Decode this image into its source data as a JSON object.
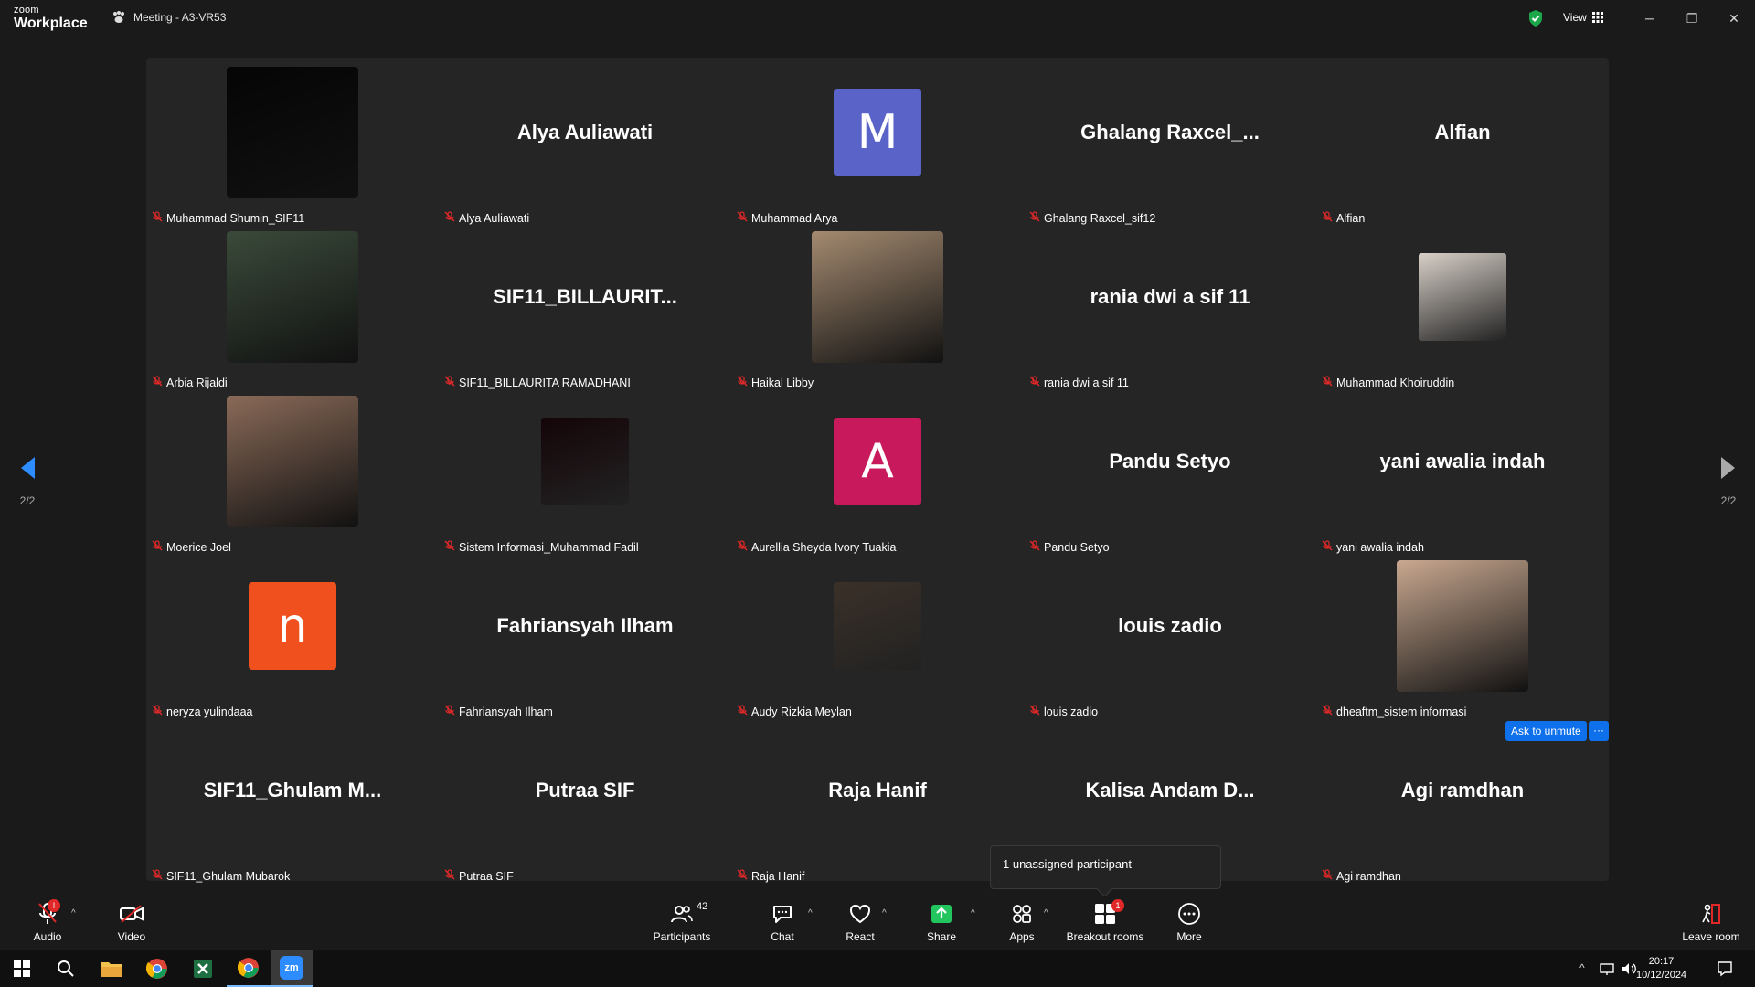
{
  "app": {
    "logo_top": "zoom",
    "logo_bottom": "Workplace",
    "meeting_title": "Meeting - A3-VR53",
    "view_label": "View"
  },
  "tiles": [
    {
      "label": "Muhammad Shumin_SIF11",
      "kind": "video",
      "color": "#050505"
    },
    {
      "label": "Alya Auliawati",
      "kind": "name",
      "display": "Alya Auliawati"
    },
    {
      "label": "Muhammad Arya",
      "kind": "avatar",
      "initial": "M",
      "color": "#5a64c8"
    },
    {
      "label": "Ghalang Raxcel_sif12",
      "kind": "name",
      "display": "Ghalang  Raxcel_..."
    },
    {
      "label": "Alfian",
      "kind": "name",
      "display": "Alfian"
    },
    {
      "label": "Arbia Rijaldi",
      "kind": "video",
      "color": "#3a4a3a"
    },
    {
      "label": "SIF11_BILLAURITA RAMADHANI",
      "kind": "name",
      "display": "SIF11_BILLAURIT..."
    },
    {
      "label": "Haikal Libby",
      "kind": "video",
      "color": "#a48a70"
    },
    {
      "label": "rania dwi a sif 11",
      "kind": "name",
      "display": "rania dwi a sif 11"
    },
    {
      "label": "Muhammad Khoiruddin",
      "kind": "photo",
      "color": "#d8d0c8"
    },
    {
      "label": "Moerice Joel",
      "kind": "video",
      "color": "#8a6a58"
    },
    {
      "label": "Sistem Informasi_Muhammad Fadil",
      "kind": "photo",
      "color": "#140508"
    },
    {
      "label": "Aurellia Sheyda Ivory Tuakia",
      "kind": "avatar",
      "initial": "A",
      "color": "#c8195c"
    },
    {
      "label": "Pandu Setyo",
      "kind": "name",
      "display": "Pandu Setyo"
    },
    {
      "label": "yani awalia indah",
      "kind": "name",
      "display": "yani awalia indah"
    },
    {
      "label": "neryza yulindaaa",
      "kind": "avatar",
      "initial": "n",
      "color": "#f0501e"
    },
    {
      "label": "Fahriansyah Ilham",
      "kind": "name",
      "display": "Fahriansyah Ilham"
    },
    {
      "label": "Audy Rizkia Meylan",
      "kind": "photo",
      "color": "#3a3028"
    },
    {
      "label": "louis zadio",
      "kind": "name",
      "display": "louis zadio"
    },
    {
      "label": "dheaftm_sistem informasi",
      "kind": "video",
      "color": "#c9a890"
    },
    {
      "label": "SIF11_Ghulam Mubarok",
      "kind": "name",
      "display": "SIF11_Ghulam  M..."
    },
    {
      "label": "Putraa SIF",
      "kind": "name",
      "display": "Putraa SIF"
    },
    {
      "label": "Raja Hanif",
      "kind": "name",
      "display": "Raja Hanif"
    },
    {
      "label": "",
      "kind": "name",
      "display": "Kalisa  Andam  D..."
    },
    {
      "label": "Agi ramdhan",
      "kind": "name",
      "display": "Agi ramdhan"
    }
  ],
  "pager": {
    "left": "2/2",
    "right": "2/2"
  },
  "ask_unmute": "Ask to unmute",
  "ask_more": "···",
  "tooltip": "1 unassigned participant",
  "toolbar": {
    "audio": "Audio",
    "video": "Video",
    "participants": "Participants",
    "participants_count": "42",
    "chat": "Chat",
    "react": "React",
    "share": "Share",
    "apps": "Apps",
    "breakout": "Breakout rooms",
    "breakout_badge": "1",
    "audio_badge": "!",
    "more": "More",
    "leave": "Leave room"
  },
  "taskbar": {
    "zoom_label": "zm",
    "time": "20:17",
    "date": "10/12/2024"
  },
  "colors": {
    "accent": "#0e71eb",
    "mute_red": "#e02828",
    "share_green": "#22c55e"
  }
}
